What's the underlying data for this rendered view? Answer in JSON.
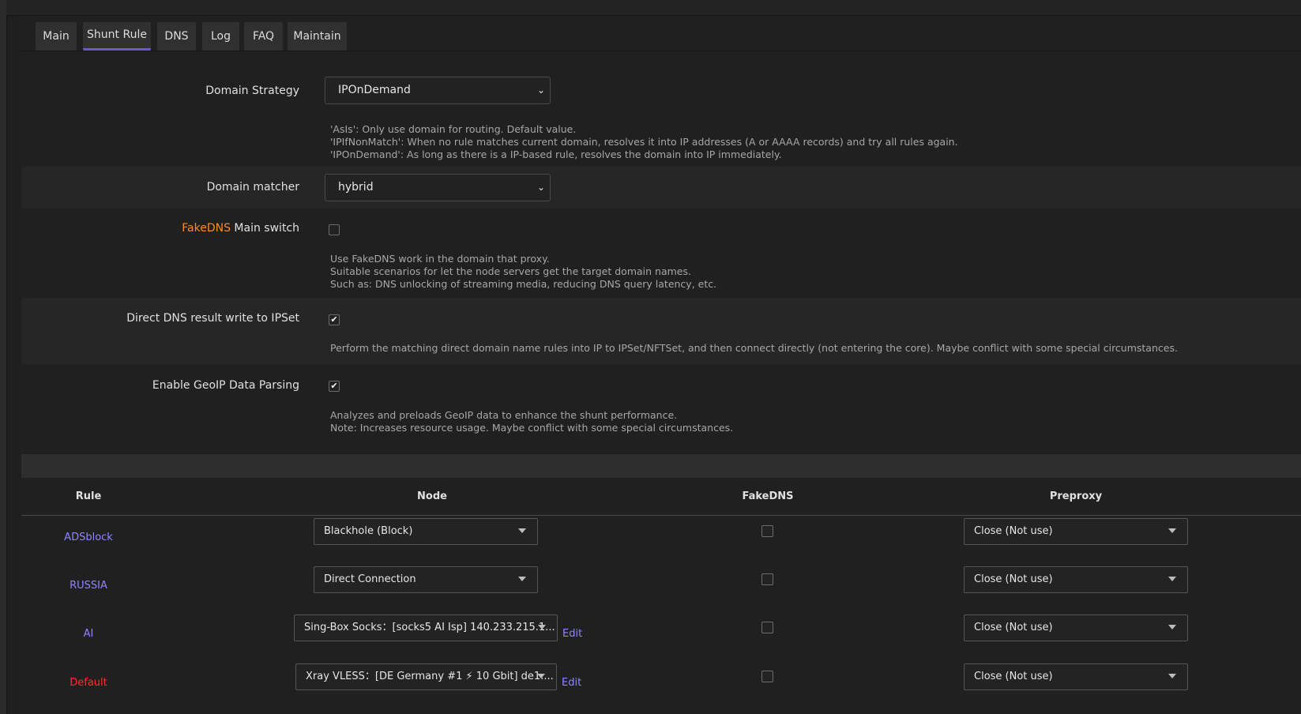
{
  "tabs": [
    "Main",
    "Shunt Rule",
    "DNS",
    "Log",
    "FAQ",
    "Maintain"
  ],
  "active_tab": "Shunt Rule",
  "domain_strategy": {
    "label": "Domain Strategy",
    "value": "IPOnDemand",
    "desc": [
      "'AsIs': Only use domain for routing. Default value.",
      "'IPIfNonMatch': When no rule matches current domain, resolves it into IP addresses (A or AAAA records) and try all rules again.",
      "'IPOnDemand': As long as there is a IP-based rule, resolves the domain into IP immediately."
    ]
  },
  "domain_matcher": {
    "label": "Domain matcher",
    "value": "hybrid"
  },
  "fakedns": {
    "label_prefix": "FakeDNS",
    "label_suffix": " Main switch",
    "checked": false,
    "desc": [
      "Use FakeDNS work in the domain that proxy.",
      "Suitable scenarios for let the node servers get the target domain names.",
      "Such as: DNS unlocking of streaming media, reducing DNS query latency, etc."
    ]
  },
  "direct_dns": {
    "label": "Direct DNS result write to IPSet",
    "checked": true,
    "desc": "Perform the matching direct domain name rules into IP to IPSet/NFTSet, and then connect directly (not entering the core). Maybe conflict with some special circumstances."
  },
  "geoip": {
    "label": "Enable GeoIP Data Parsing",
    "checked": true,
    "desc": [
      "Analyzes and preloads GeoIP data to enhance the shunt performance.",
      "Note: Increases resource usage. Maybe conflict with some special circumstances."
    ]
  },
  "table": {
    "headers": {
      "rule": "Rule",
      "node": "Node",
      "fakedns": "FakeDNS",
      "preproxy": "Preproxy"
    },
    "rows": [
      {
        "rule": "ADSblock",
        "node": "Blackhole (Block)",
        "edit": "",
        "fakedns": false,
        "preproxy": "Close (Not use)"
      },
      {
        "rule": "RUSSIA",
        "node": "Direct Connection",
        "edit": "",
        "fakedns": false,
        "preproxy": "Close (Not use)"
      },
      {
        "rule": "AI",
        "node": "Sing-Box Socks：[socks5 AI Isp] 140.233.215.1...",
        "edit": "Edit",
        "fakedns": false,
        "preproxy": "Close (Not use)"
      },
      {
        "rule": "Default",
        "node": "Xray VLESS：[DE Germany #1 ⚡ 10 Gbit] de1....",
        "edit": "Edit",
        "fakedns": false,
        "preproxy": "Close (Not use)"
      }
    ]
  },
  "colors": {
    "accent": "#6a5acd",
    "orange": "#ff8a1f",
    "red": "#ff2d2d",
    "link": "#8f86ff"
  }
}
